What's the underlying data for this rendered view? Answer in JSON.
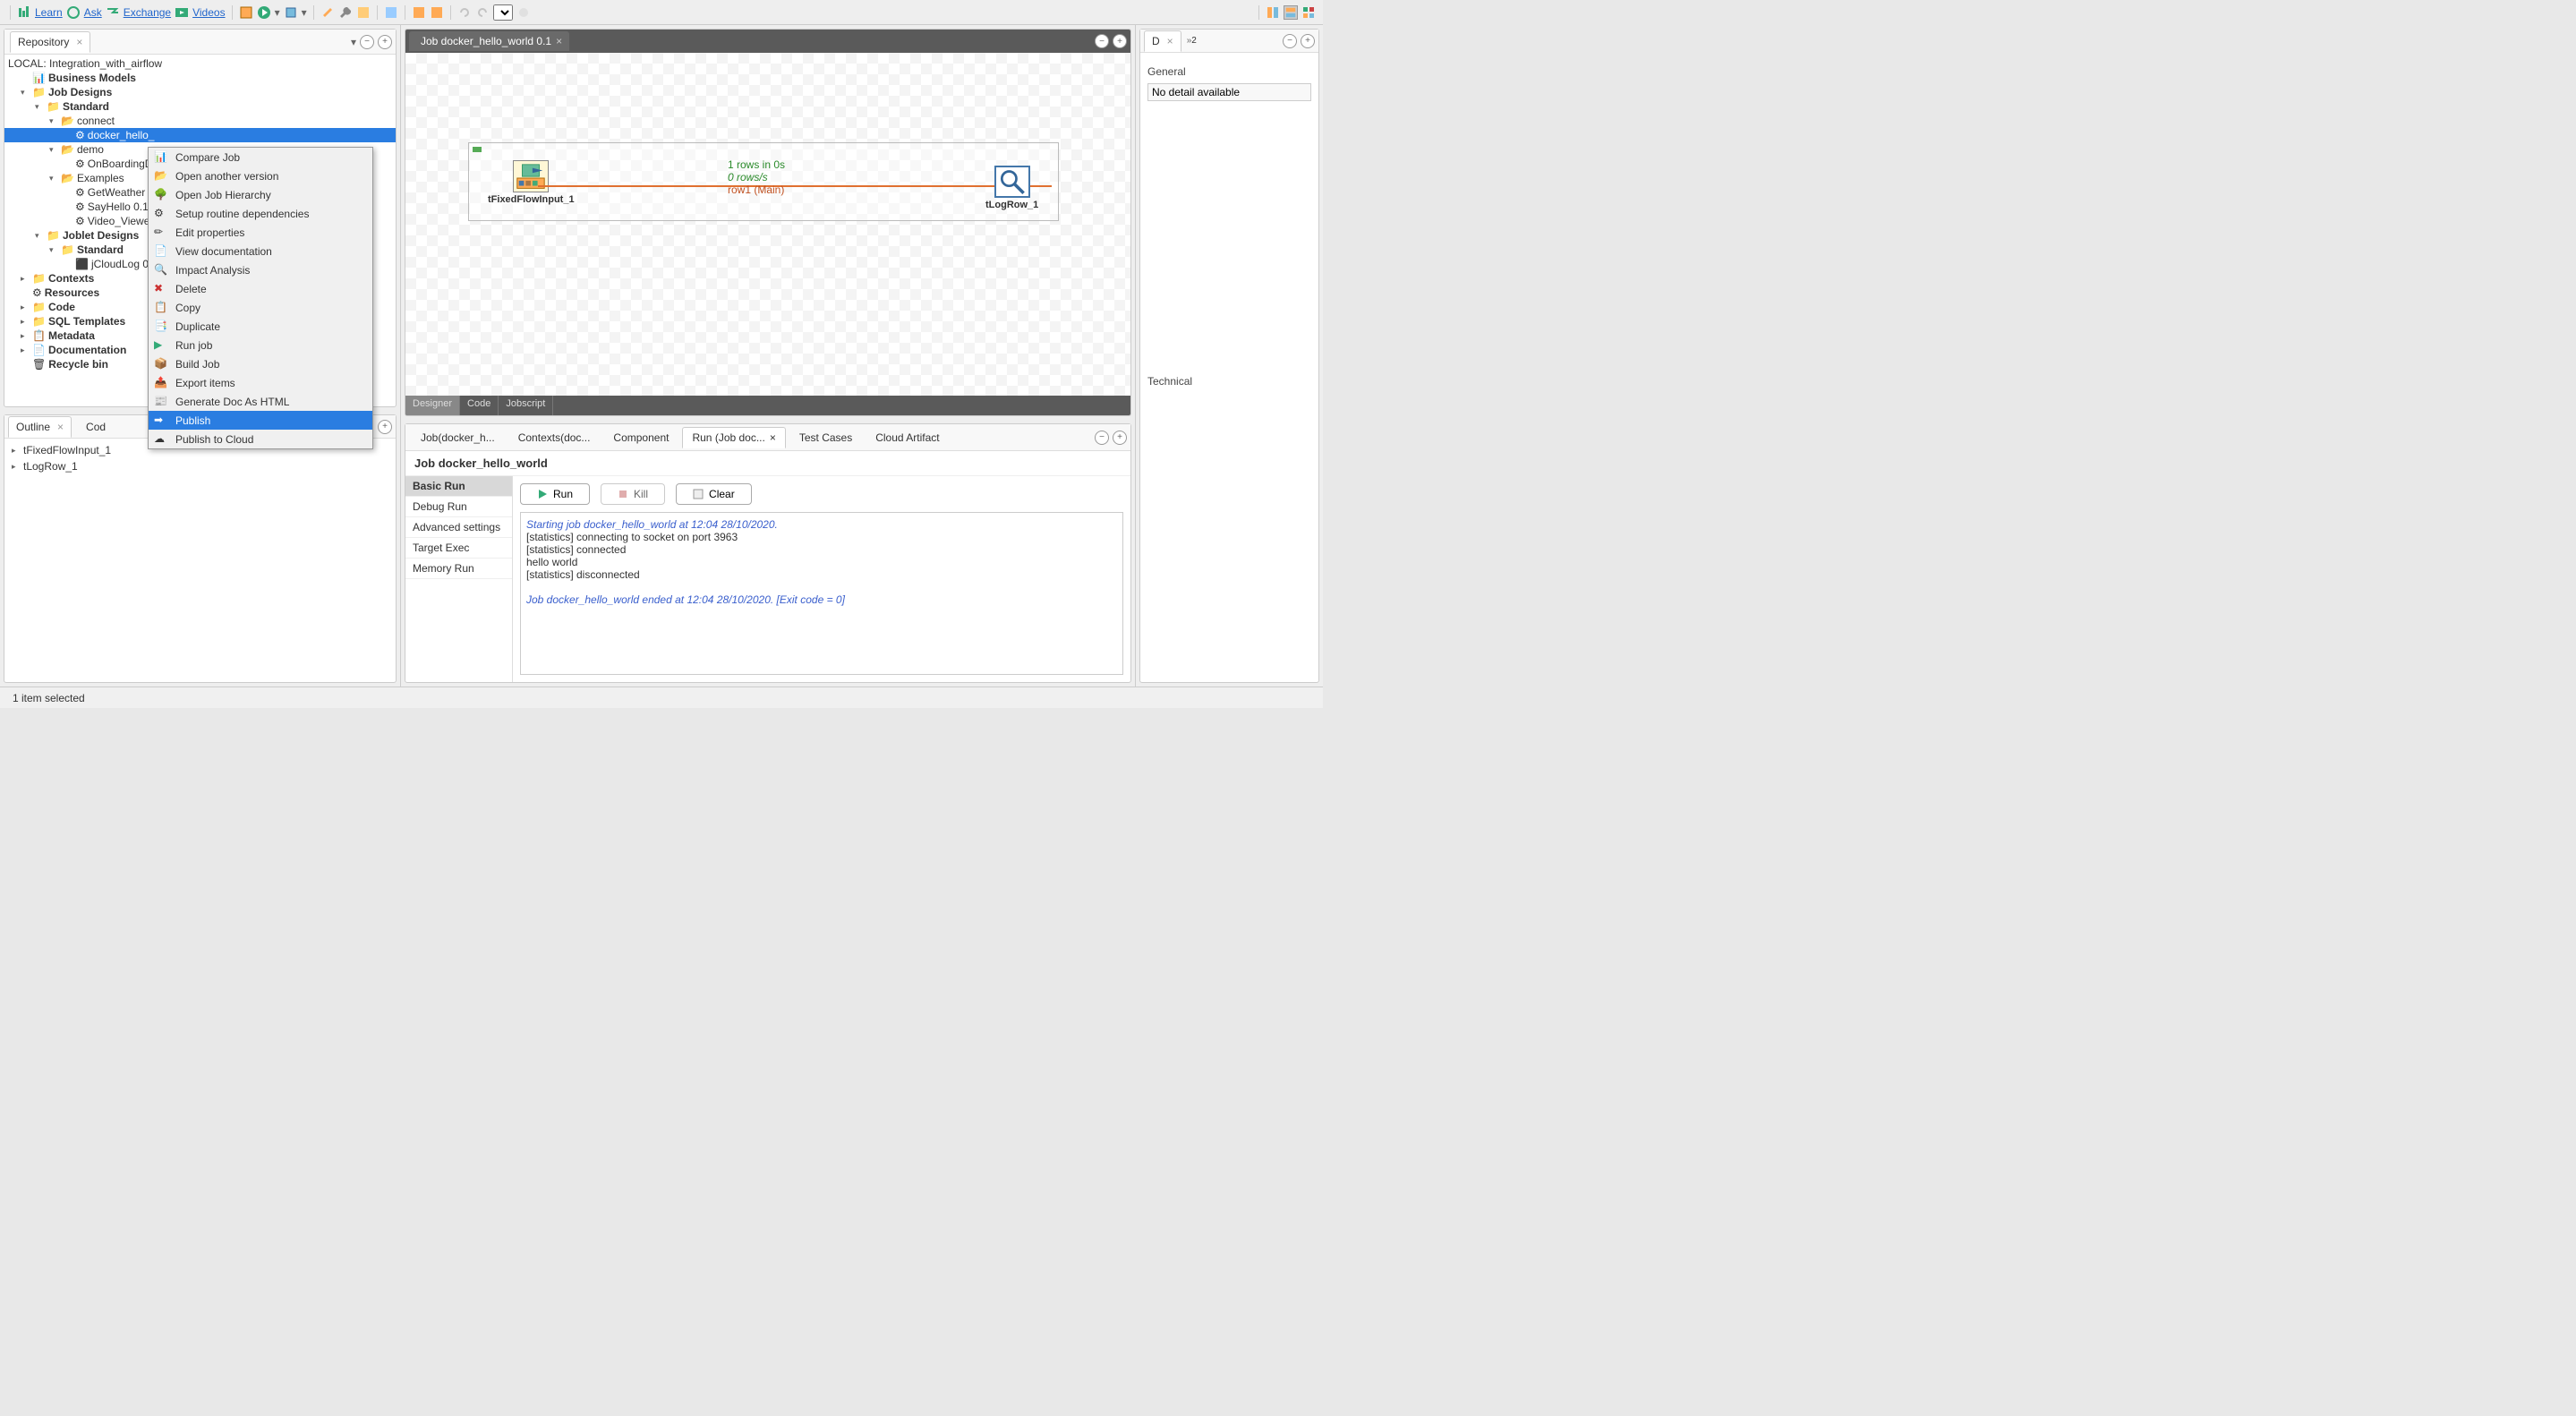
{
  "toolbar": {
    "links": {
      "learn": "Learn",
      "ask": "Ask",
      "exchange": "Exchange",
      "videos": "Videos"
    }
  },
  "repo": {
    "title": "Repository",
    "project": "LOCAL: Integration_with_airflow",
    "business_models": "Business Models",
    "job_designs": "Job Designs",
    "standard": "Standard",
    "connect": "connect",
    "docker_hello": "docker_hello_",
    "demo": "demo",
    "onboarding": "OnBoardingD",
    "examples": "Examples",
    "get_weather": "GetWeather",
    "say_hello": "SayHello 0.1",
    "video_viewe": "Video_Viewe",
    "joblet": "Joblet Designs",
    "standard2": "Standard",
    "jcloudlog": "jCloudLog 0.",
    "contexts": "Contexts",
    "resources": "Resources",
    "code": "Code",
    "sql_templates": "SQL Templates",
    "metadata": "Metadata",
    "documentation": "Documentation",
    "recycle": "Recycle bin"
  },
  "context_menu": {
    "compare": "Compare Job",
    "open_another": "Open another version",
    "open_hierarchy": "Open Job Hierarchy",
    "setup_routine": "Setup routine dependencies",
    "edit_props": "Edit properties",
    "view_doc": "View documentation",
    "impact": "Impact Analysis",
    "delete": "Delete",
    "copy": "Copy",
    "duplicate": "Duplicate",
    "run_job": "Run job",
    "build_job": "Build Job",
    "export_items": "Export items",
    "generate_doc": "Generate Doc As HTML",
    "publish": "Publish",
    "publish_cloud": "Publish to Cloud"
  },
  "editor": {
    "tab": "Job docker_hello_world 0.1",
    "comp1": "tFixedFlowInput_1",
    "comp2": "tLogRow_1",
    "flow_rows": "1 rows in 0s",
    "flow_rate": "0 rows/s",
    "flow_name": "row1 (Main)",
    "dtab_designer": "Designer",
    "dtab_code": "Code",
    "dtab_jobscript": "Jobscript"
  },
  "bottom": {
    "tab_job": "Job(docker_h...",
    "tab_contexts": "Contexts(doc...",
    "tab_component": "Component",
    "tab_run": "Run (Job doc...",
    "tab_testcases": "Test Cases",
    "tab_cloud": "Cloud Artifact",
    "job_title": "Job docker_hello_world",
    "basic_run": "Basic Run",
    "debug_run": "Debug Run",
    "advanced": "Advanced settings",
    "target_exec": "Target Exec",
    "memory_run": "Memory Run",
    "btn_run": "Run",
    "btn_kill": "Kill",
    "btn_clear": "Clear",
    "console_line1": "Starting job docker_hello_world at 12:04 28/10/2020.",
    "console_line2": "[statistics] connecting to socket on port 3963",
    "console_line3": "[statistics] connected",
    "console_line4": "hello world",
    "console_line5": "[statistics] disconnected",
    "console_line6": "Job docker_hello_world ended at 12:04 28/10/2020. [Exit code  = 0]"
  },
  "outline": {
    "tab_outline": "Outline",
    "tab_cod": "Cod",
    "item1": "tFixedFlowInput_1",
    "item2": "tLogRow_1"
  },
  "right": {
    "tab_d": "D",
    "badge_2": "2",
    "general": "General",
    "no_detail": "No detail available",
    "technical": "Technical"
  },
  "status": {
    "text": "1 item selected"
  }
}
